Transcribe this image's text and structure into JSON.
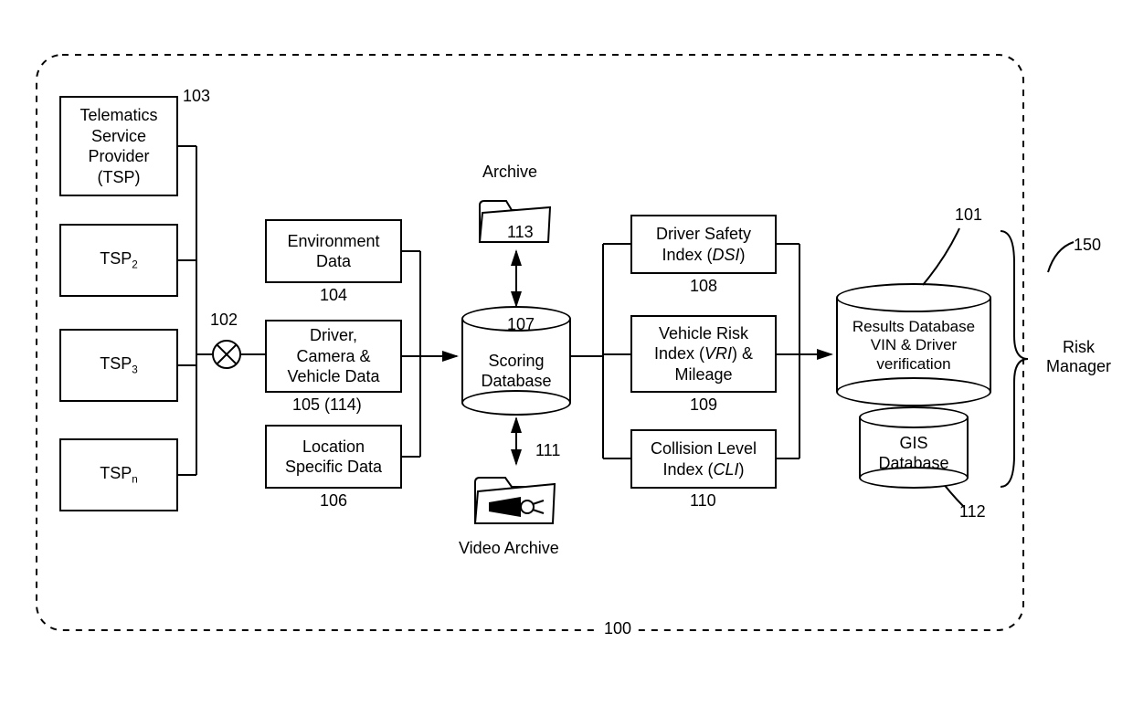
{
  "tsp": {
    "b1_l1": "Telematics",
    "b1_l2": "Service",
    "b1_l3": "Provider",
    "b1_l4": "(TSP)",
    "b2": "TSP",
    "b2_sub": "2",
    "b3": "TSP",
    "b3_sub": "3",
    "bn": "TSP",
    "bn_sub": "n"
  },
  "ref": {
    "r100": "100",
    "r101": "101",
    "r102": "102",
    "r103": "103",
    "r104": "104",
    "r105": "105  (114)",
    "r106": "106",
    "r107": "107",
    "r108": "108",
    "r109": "109",
    "r110": "110",
    "r111": "111",
    "r112": "112",
    "r113": "113",
    "r150": "150"
  },
  "mid": {
    "env_l1": "Environment",
    "env_l2": "Data",
    "drv_l1": "Driver,",
    "drv_l2": "Camera &",
    "drv_l3": "Vehicle Data",
    "loc_l1": "Location",
    "loc_l2": "Specific Data"
  },
  "archive": {
    "title_top": "Archive",
    "title_bottom": "Video Archive"
  },
  "db": {
    "scoring_l1": "Scoring",
    "scoring_l2": "Database",
    "results_l1": "Results Database",
    "results_l2": "VIN & Driver",
    "results_l3": "verification",
    "gis_l1": "GIS",
    "gis_l2": "Database"
  },
  "idx": {
    "dsi_l1": "Driver Safety",
    "dsi_l2": "Index (",
    "dsi_em": "DSI",
    "dsi_l3": ")",
    "vri_l1": "Vehicle Risk",
    "vri_l2": "Index (",
    "vri_em": "VRI",
    "vri_l3": ") &",
    "vri_l4": "Mileage",
    "cli_l1": "Collision Level",
    "cli_l2": "Index (",
    "cli_em": "CLI",
    "cli_l3": ")"
  },
  "out": {
    "risk_l1": "Risk",
    "risk_l2": "Manager"
  }
}
